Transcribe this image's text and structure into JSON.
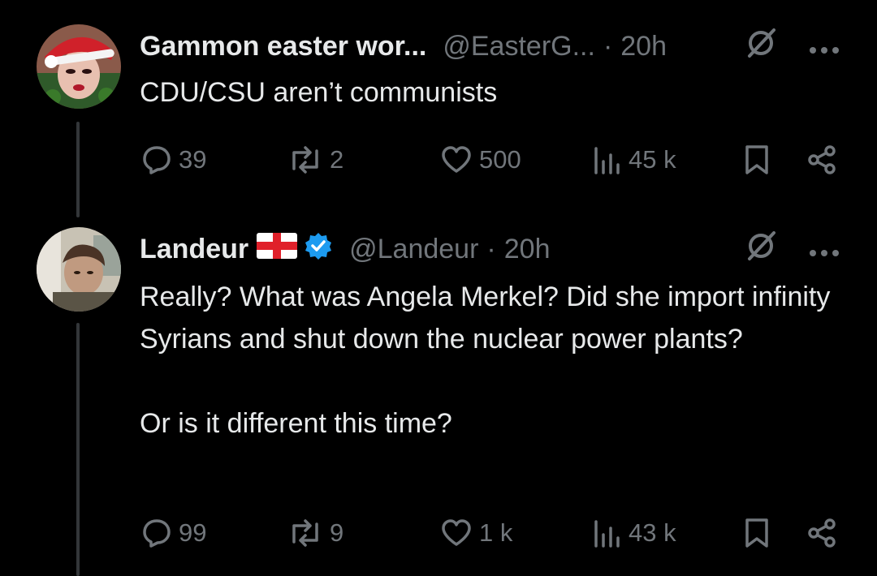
{
  "colors": {
    "background": "#000000",
    "primary_text": "#e7e9ea",
    "secondary_text": "#71767b",
    "verified_blue": "#1d9bf0",
    "thread_line": "#333639"
  },
  "tweets": [
    {
      "display_name": "Gammon easter wor...",
      "handle": "@EasterG...",
      "separator": "·",
      "time": "20h",
      "avatar_icon": "santa-hat-avatar",
      "text": "CDU/CSU aren’t communists",
      "counts": {
        "replies": "39",
        "reposts": "2",
        "likes": "500",
        "views": "45 k"
      }
    },
    {
      "display_name": "Landeur",
      "flag_icon": "england-flag-icon",
      "verified_icon": "verified-badge-icon",
      "handle": "@Landeur",
      "separator": "·",
      "time": "20h",
      "avatar_icon": "person-avatar",
      "text": "Really? What was Angela Merkel? Did she import infinity Syrians and shut down the nuclear power plants?\n\nOr is it different this time?",
      "counts": {
        "replies": "99",
        "reposts": "9",
        "likes": "1 k",
        "views": "43 k"
      }
    }
  ]
}
